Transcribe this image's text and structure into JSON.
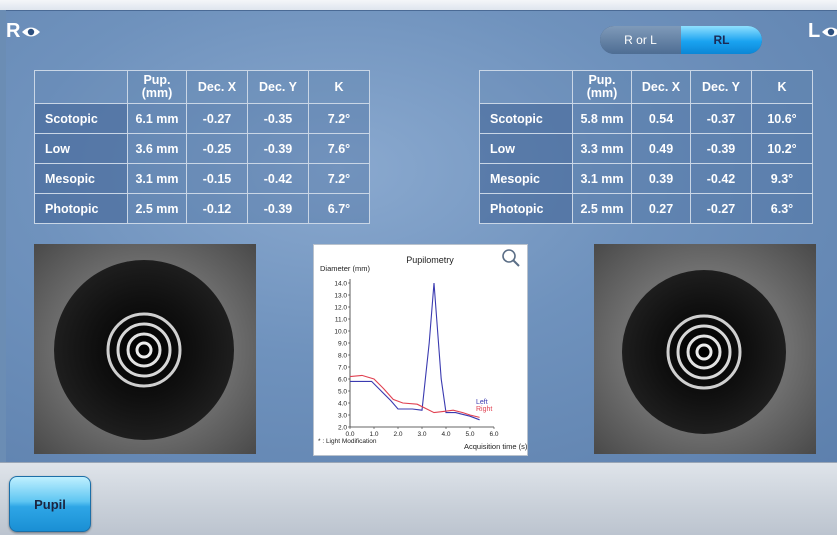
{
  "header": {
    "left_eye_label": "R",
    "right_eye_label": "L",
    "toggle": {
      "options": [
        "R or L",
        "RL"
      ],
      "active": "RL"
    }
  },
  "tables": {
    "columns": [
      "Pup.\n(mm)",
      "Dec. X",
      "Dec. Y",
      "K"
    ],
    "right_eye_rows": [
      {
        "label": "Scotopic",
        "values": [
          "6.1 mm",
          "-0.27",
          "-0.35",
          "7.2°"
        ]
      },
      {
        "label": "Low",
        "values": [
          "3.6 mm",
          "-0.25",
          "-0.39",
          "7.6°"
        ]
      },
      {
        "label": "Mesopic",
        "values": [
          "3.1 mm",
          "-0.15",
          "-0.42",
          "7.2°"
        ]
      },
      {
        "label": "Photopic",
        "values": [
          "2.5 mm",
          "-0.12",
          "-0.39",
          "6.7°"
        ]
      }
    ],
    "left_eye_rows": [
      {
        "label": "Scotopic",
        "values": [
          "5.8 mm",
          "0.54",
          "-0.37",
          "10.6°"
        ]
      },
      {
        "label": "Low",
        "values": [
          "3.3 mm",
          "0.49",
          "-0.39",
          "10.2°"
        ]
      },
      {
        "label": "Mesopic",
        "values": [
          "3.1 mm",
          "0.39",
          "-0.42",
          "9.3°"
        ]
      },
      {
        "label": "Photopic",
        "values": [
          "2.5 mm",
          "0.27",
          "-0.27",
          "6.3°"
        ]
      }
    ]
  },
  "chart_data": {
    "type": "line",
    "title": "Pupilometry",
    "ylabel": "Diameter (mm)",
    "xlabel": "Acquisition time (s)",
    "footnote": "* : Light Modification",
    "xlim": [
      0,
      6
    ],
    "ylim": [
      2,
      14
    ],
    "x_ticks": [
      "0.0",
      "1.0",
      "2.0",
      "3.0",
      "4.0",
      "5.0",
      "6.0"
    ],
    "y_ticks": [
      "2.0",
      "3.0",
      "4.0",
      "5.0",
      "6.0",
      "7.0",
      "8.0",
      "9.0",
      "10.0",
      "11.0",
      "12.0",
      "13.0",
      "14.0"
    ],
    "series": [
      {
        "name": "Left",
        "color": "#3a3ab0",
        "x": [
          0,
          0.9,
          1.3,
          1.7,
          2.0,
          2.6,
          3.0,
          3.3,
          3.5,
          3.8,
          4.0,
          4.4,
          4.6,
          5.0,
          5.4
        ],
        "y": [
          5.8,
          5.8,
          5.0,
          4.2,
          3.5,
          3.5,
          3.4,
          9.0,
          14.0,
          6.0,
          3.2,
          3.2,
          3.1,
          2.9,
          2.6
        ]
      },
      {
        "name": "Right",
        "color": "#e04050",
        "x": [
          0,
          0.5,
          1.0,
          1.4,
          1.8,
          2.2,
          2.8,
          3.2,
          3.5,
          3.9,
          4.3,
          4.7,
          5.0,
          5.4
        ],
        "y": [
          6.2,
          6.3,
          6.0,
          5.2,
          4.3,
          4.0,
          3.9,
          3.5,
          3.2,
          3.3,
          3.4,
          3.2,
          3.0,
          2.8
        ]
      }
    ]
  },
  "footer": {
    "pupil_button": "Pupil"
  },
  "icons": {
    "zoom": "magnifier-icon",
    "eye": "eye-icon"
  }
}
